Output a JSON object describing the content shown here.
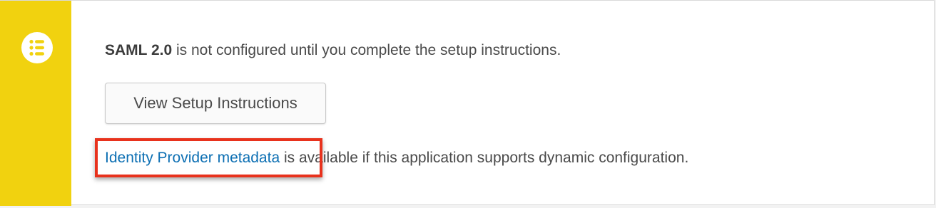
{
  "colors": {
    "accent": "#f1d20f",
    "link": "#0c6fb3",
    "highlight": "#e8321d"
  },
  "notice": {
    "icon": "list-icon",
    "app_name": "SAML 2.0",
    "message_rest": " is not configured until you complete the setup instructions.",
    "setup_button_label": "View Setup Instructions",
    "metadata_link_label": "Identity Provider metadata",
    "metadata_rest": " is available if this application supports dynamic configuration."
  }
}
